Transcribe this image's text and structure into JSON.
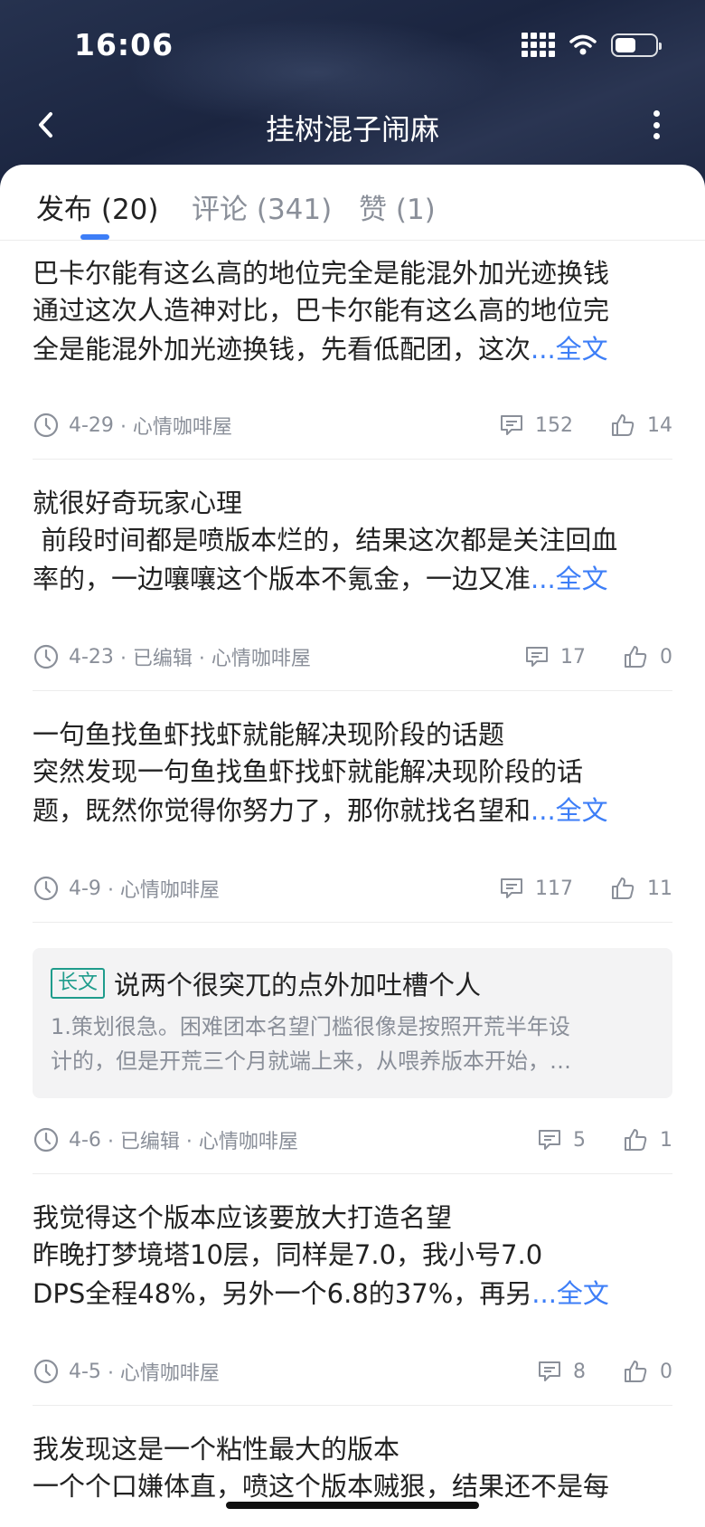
{
  "status_bar": {
    "time": "16:06"
  },
  "nav": {
    "title": "挂树混子闹麻"
  },
  "tabs": [
    {
      "label": "发布 (20)"
    },
    {
      "label": "评论 (341)"
    },
    {
      "label": "赞 (1)"
    }
  ],
  "more_label": "...全文",
  "posts": [
    {
      "title": "巴卡尔能有这么高的地位完全是能混外加光迹换钱",
      "body_line1": "通过这次人造神对比，巴卡尔能有这么高的地位完",
      "body_line2": "全是能混外加光迹换钱，先看低配团，这次",
      "date": "4-29",
      "meta": "· 心情咖啡屋",
      "comments": "152",
      "likes": "14"
    },
    {
      "title": "就很好奇玩家心理",
      "body_line1": " 前段时间都是喷版本烂的，结果这次都是关注回血",
      "body_line2": "率的，一边嚷嚷这个版本不氪金，一边又准",
      "date": "4-23",
      "meta": "· 已编辑 · 心情咖啡屋",
      "comments": "17",
      "likes": "0"
    },
    {
      "title": "一句鱼找鱼虾找虾就能解决现阶段的话题",
      "body_line1": "突然发现一句鱼找鱼虾找虾就能解决现阶段的话",
      "body_line2": "题，既然你觉得你努力了，那你就找名望和",
      "date": "4-9",
      "meta": "· 心情咖啡屋",
      "comments": "117",
      "likes": "11"
    },
    {
      "badge": "长文",
      "title": "说两个很突兀的点外加吐槽个人",
      "body_line1": "1.策划很急。困难团本名望门槛很像是按照开荒半年设",
      "body_line2": "计的，但是开荒三个月就端上来，从喂养版本开始，…",
      "date": "4-6",
      "meta": "· 已编辑 · 心情咖啡屋",
      "comments": "5",
      "likes": "1"
    },
    {
      "title": "我觉得这个版本应该要放大打造名望",
      "body_line1": "昨晚打梦境塔10层，同样是7.0，我小号7.0",
      "body_line2": "DPS全程48%，另外一个6.8的37%，再另",
      "date": "4-5",
      "meta": "· 心情咖啡屋",
      "comments": "8",
      "likes": "0"
    },
    {
      "title": "我发现这是一个粘性最大的版本",
      "body_line1": "一个个口嫌体直，喷这个版本贼狠，结果还不是每"
    }
  ]
}
